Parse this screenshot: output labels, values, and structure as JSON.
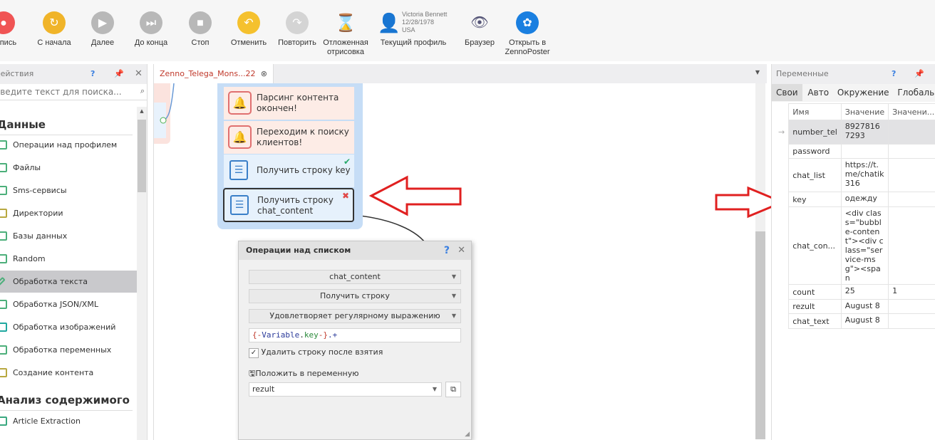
{
  "toolbar": {
    "buttons": [
      {
        "label": "Запись",
        "icon": "record-icon",
        "color": "#f05454"
      },
      {
        "label": "С начала",
        "icon": "restart-icon",
        "color": "#f0b429"
      },
      {
        "label": "Далее",
        "icon": "play-icon",
        "color": "#b8b8b8"
      },
      {
        "label": "До конца",
        "icon": "skip-end-icon",
        "color": "#b8b8b8"
      },
      {
        "label": "Стоп",
        "icon": "stop-icon",
        "color": "#b8b8b8"
      },
      {
        "label": "Отменить",
        "icon": "undo-icon",
        "color": "#f5c12e"
      },
      {
        "label": "Повторить",
        "icon": "redo-icon",
        "color": "#d4d4d4"
      },
      {
        "label": "Отложенная отрисовка",
        "icon": "hourglass-icon",
        "color": ""
      },
      {
        "label": "Текущий профиль",
        "icon": "profile-icon",
        "color": ""
      },
      {
        "label": "Браузер",
        "icon": "eye-icon",
        "color": ""
      },
      {
        "label": "Открыть в ZennoPoster",
        "icon": "zennoposter-icon",
        "color": "#1a7fe0"
      }
    ],
    "profile": {
      "name": "Victoria Bennett",
      "dob": "12/28/1978",
      "country": "USA"
    }
  },
  "left": {
    "title": "Действия",
    "search_placeholder": "Введите текст для поиска...",
    "section1": "Данные",
    "items": [
      "Операции над профилем",
      "Файлы",
      "Sms-сервисы",
      "Директории",
      "Базы данных",
      "Random",
      "Обработка текста",
      "Обработка JSON/XML",
      "Обработка изображений",
      "Обработка переменных",
      "Создание контента"
    ],
    "selected": "Обработка текста",
    "section2": "Анализ содержимого",
    "items2": [
      "Article Extraction"
    ]
  },
  "tab": {
    "label": "Zenno_Telega_Mons...22"
  },
  "nodes": [
    {
      "label": "Парсинг контента окончен!"
    },
    {
      "label": "Переходим к поиску клиентов!"
    },
    {
      "label": "Получить строку key",
      "status": "✔"
    },
    {
      "label": "Получить строку chat_content",
      "status": "✖"
    }
  ],
  "dialog": {
    "title": "Операции над списком",
    "list": "chat_content",
    "operation": "Получить строку",
    "condition": "Удовлетворяет регулярному выражению",
    "regex_parts": [
      "{-",
      "Variable",
      ".",
      "key",
      "-}",
      ".+"
    ],
    "delete_label": "Удалить строку после взятия",
    "delete_checked": true,
    "save_label": "Положить в переменную",
    "save_var": "rezult"
  },
  "right": {
    "title": "Переменные",
    "tabs": [
      "Свои",
      "Авто",
      "Окружение",
      "Глобальные"
    ],
    "columns": [
      "Имя",
      "Значение",
      "Значени..."
    ],
    "rows": [
      {
        "name": "number_tel",
        "value": "89278167293",
        "value2": ""
      },
      {
        "name": "password",
        "value": "",
        "value2": ""
      },
      {
        "name": "chat_list",
        "value": "https://t.me/chatik316",
        "value2": ""
      },
      {
        "name": "key",
        "value": "одежду",
        "value2": ""
      },
      {
        "name": "chat_con...",
        "value": "<div class=\"bubble-content\"><div class=\"service-msg\"><span",
        "value2": ""
      },
      {
        "name": "count",
        "value": "25",
        "value2": "1"
      },
      {
        "name": "rezult",
        "value": "August 8",
        "value2": ""
      },
      {
        "name": "chat_text",
        "value": "August 8",
        "value2": ""
      }
    ]
  }
}
